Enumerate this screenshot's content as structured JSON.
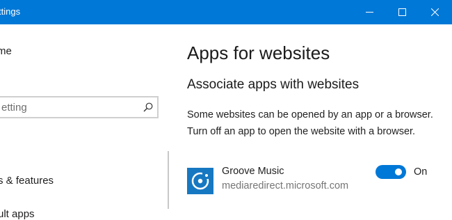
{
  "window": {
    "title": "ttings",
    "accent_color": "#0078d7",
    "controls": [
      "minimize-icon",
      "maximize-icon",
      "close-icon"
    ]
  },
  "sidebar": {
    "home_label": "me",
    "search": {
      "placeholder": "etting",
      "icon": "search-icon"
    },
    "items": [
      {
        "label": "s & features"
      },
      {
        "label": "ult apps"
      }
    ]
  },
  "main": {
    "page_title": "Apps for websites",
    "section_title": "Associate apps with websites",
    "description": "Some websites can be opened by an app or a browser.  Turn off an app to open the website with a browser.",
    "apps": [
      {
        "name": "Groove Music",
        "url": "mediaredirect.microsoft.com",
        "icon": "groove-music-icon",
        "toggle_state": "On",
        "toggle_on": true
      }
    ]
  }
}
